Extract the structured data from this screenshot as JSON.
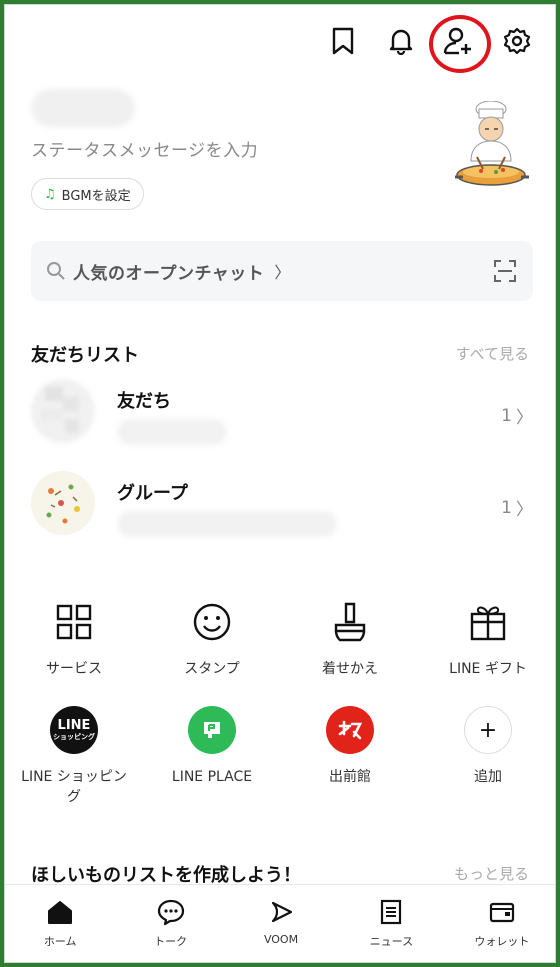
{
  "top_icons": [
    "bookmark-icon",
    "bell-icon",
    "add-friend-icon",
    "settings-gear-icon"
  ],
  "highlight_color": "#e1141c",
  "frame_color": "#2f7d32",
  "profile": {
    "status_placeholder": "ステータスメッセージを入力",
    "bgm_label": "BGMを設定"
  },
  "search": {
    "text": "人気のオープンチャット"
  },
  "friends_section": {
    "title": "友だちリスト",
    "more": "すべて見る",
    "rows": [
      {
        "label": "友だち",
        "count": "1"
      },
      {
        "label": "グループ",
        "count": "1"
      }
    ]
  },
  "services": [
    {
      "label": "サービス",
      "icon": "grid-icon"
    },
    {
      "label": "スタンプ",
      "icon": "smiley-icon"
    },
    {
      "label": "着せかえ",
      "icon": "brush-icon"
    },
    {
      "label": "LINE ギフト",
      "icon": "gift-icon"
    }
  ],
  "services2": [
    {
      "label": "LINE ショッピング",
      "icon_text": "LINE",
      "icon_sub": "ショッピング",
      "color": "#111111"
    },
    {
      "label": "LINE PLACE",
      "color": "#2ebb57"
    },
    {
      "label": "出前館",
      "color": "#e2231a"
    },
    {
      "label": "追加",
      "icon_text": "+"
    }
  ],
  "wish_section": {
    "title": "ほしいものリストを作成しよう！",
    "more": "もっと見る"
  },
  "bottom_nav": [
    {
      "label": "ホーム",
      "icon": "home-icon"
    },
    {
      "label": "トーク",
      "icon": "chat-icon"
    },
    {
      "label": "VOOM",
      "icon": "voom-icon"
    },
    {
      "label": "ニュース",
      "icon": "news-icon"
    },
    {
      "label": "ウォレット",
      "icon": "wallet-icon"
    }
  ]
}
